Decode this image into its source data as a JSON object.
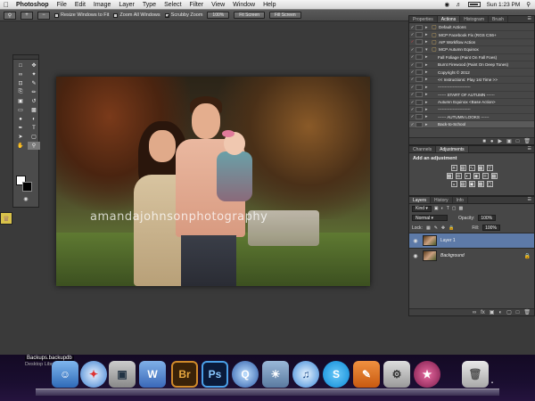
{
  "menubar": {
    "app_name": "Photoshop",
    "items": [
      "File",
      "Edit",
      "Image",
      "Layer",
      "Type",
      "Select",
      "Filter",
      "View",
      "Window",
      "Help"
    ],
    "clock": "Sun 1:23 PM"
  },
  "options": {
    "resize_windows": "Resize Windows to Fit",
    "zoom_all": "Zoom All Windows",
    "scrubby_zoom": "Scrubby Zoom",
    "btn_100": "100%",
    "btn_fit": "Fit Screen",
    "btn_fill": "Fill Screen"
  },
  "photo": {
    "watermark": "amandajohnsonphotography"
  },
  "actions_panel": {
    "tabs": [
      "Properties",
      "Actions",
      "Histogram",
      "Brush"
    ],
    "rows": [
      "Default Actions",
      "MCP Facebook Fix (RGS CS6+",
      "AIP Workflow Action",
      "MCP Autumn Equinox",
      "Fall Foliage (Paint On Fall Foes)",
      "Burnt Firewood (Paint On Deep Tones)",
      "Copyright © 2012",
      "<< Instructions: Play 1st Time >>",
      "------------------------",
      "------ START OF AUTUMN ------",
      "Autumn Equinox <Base Action>",
      "------------------------",
      "------ AUTUMN LOOKS ------",
      "Back-to-School"
    ]
  },
  "adjustments_panel": {
    "tabs": [
      "Channels",
      "Adjustments"
    ],
    "title": "Add an adjustment"
  },
  "layers_panel": {
    "tabs": [
      "Layers",
      "History",
      "Info"
    ],
    "filter_kind": "Kind",
    "blend_mode": "Normal",
    "opacity_label": "Opacity:",
    "opacity_value": "100%",
    "lock_label": "Lock:",
    "fill_label": "Fill:",
    "fill_value": "100%",
    "layers": [
      "Layer 1",
      "Background"
    ]
  },
  "dock": {
    "hover_label": "Backups.backupdb",
    "hover_sublabel": "Desktop Library"
  }
}
